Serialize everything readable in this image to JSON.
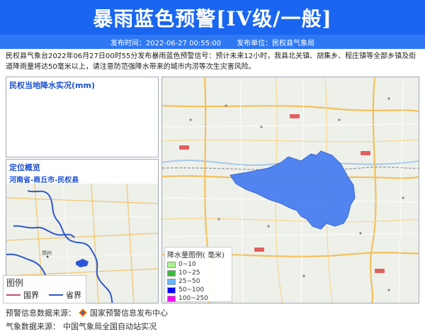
{
  "header": {
    "title": "暴雨蓝色预警[IV级/一般]",
    "publish_time": "发布时间：2022-06-27 00:55:00",
    "publisher": "发布单位：民权县气象局"
  },
  "description": "民权县气象台2022年06月27日00时55分发布暴雨蓝色预警信号：预计未来12小时，我县北关镇、胡集乡、程庄镇等全部乡镇及街道降雨量将达50毫米以上，请注意防范强降水带来的城市内涝等次生灾害风险。",
  "rain_panel": {
    "title": "民权当地降水实况(mm)"
  },
  "location_panel": {
    "title": "定位概览",
    "path": "河南省-商丘市-民权县",
    "legend": {
      "title": "图例",
      "country": "国界",
      "province": "省界"
    },
    "city_label": "郑州"
  },
  "rain_legend": {
    "title": "降水量图例( 毫米)",
    "items": [
      {
        "label": "0~10",
        "color": "#a6f28f"
      },
      {
        "label": "10~25",
        "color": "#3dba3d"
      },
      {
        "label": "25~50",
        "color": "#61b8ff"
      },
      {
        "label": "50~100",
        "color": "#0000fe"
      },
      {
        "label": "100~250",
        "color": "#fa00fa"
      }
    ]
  },
  "footer": {
    "source_warning_label": "预警信息数据来源：",
    "source_warning_value": "国家预警信息发布中心",
    "source_weather_label": "气象数据来源：",
    "source_weather_value": "中国气象局全国自动站实况"
  },
  "colors": {
    "banner": "#1a66f0",
    "warning_area": "#4a7ff0",
    "country_border": "#c0506a",
    "province_border": "#2f58c8"
  }
}
